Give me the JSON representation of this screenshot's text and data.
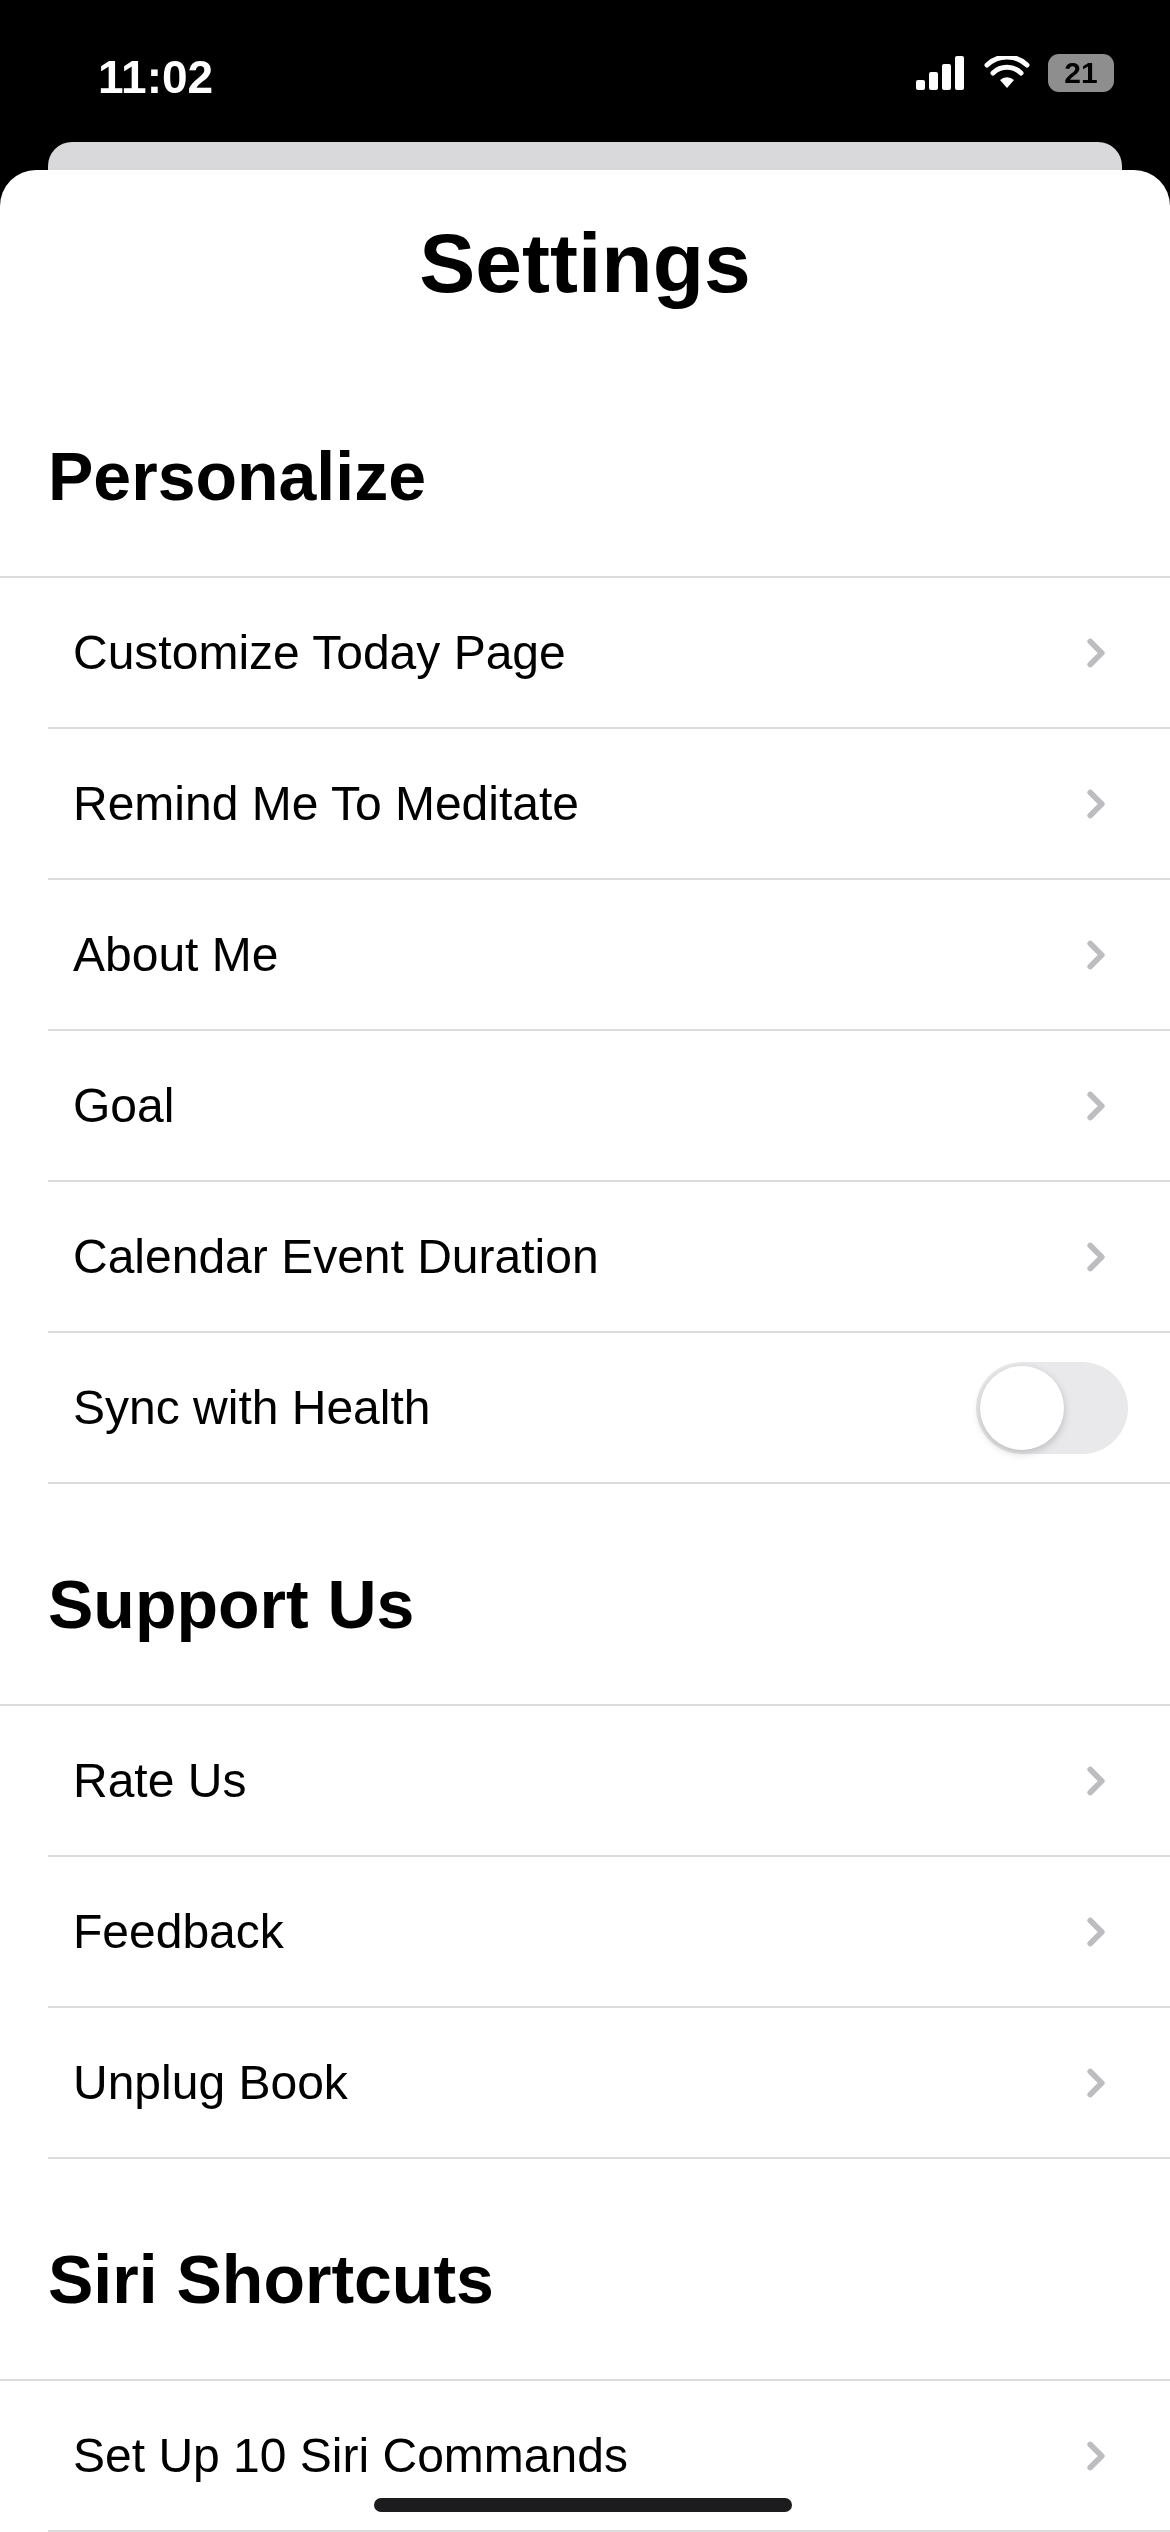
{
  "status_bar": {
    "time": "11:02",
    "battery": "21"
  },
  "title": "Settings",
  "sections": [
    {
      "title": "Personalize",
      "rows": [
        {
          "label": "Customize Today Page",
          "kind": "link"
        },
        {
          "label": "Remind Me To Meditate",
          "kind": "link"
        },
        {
          "label": "About Me",
          "kind": "link"
        },
        {
          "label": "Goal",
          "kind": "link"
        },
        {
          "label": "Calendar Event Duration",
          "kind": "link"
        },
        {
          "label": "Sync with Health",
          "kind": "toggle",
          "on": false
        }
      ]
    },
    {
      "title": "Support Us",
      "rows": [
        {
          "label": "Rate Us",
          "kind": "link"
        },
        {
          "label": "Feedback",
          "kind": "link"
        },
        {
          "label": "Unplug Book",
          "kind": "link"
        }
      ]
    },
    {
      "title": "Siri Shortcuts",
      "rows": [
        {
          "label": "Set Up 10 Siri Commands",
          "kind": "link"
        }
      ]
    }
  ]
}
